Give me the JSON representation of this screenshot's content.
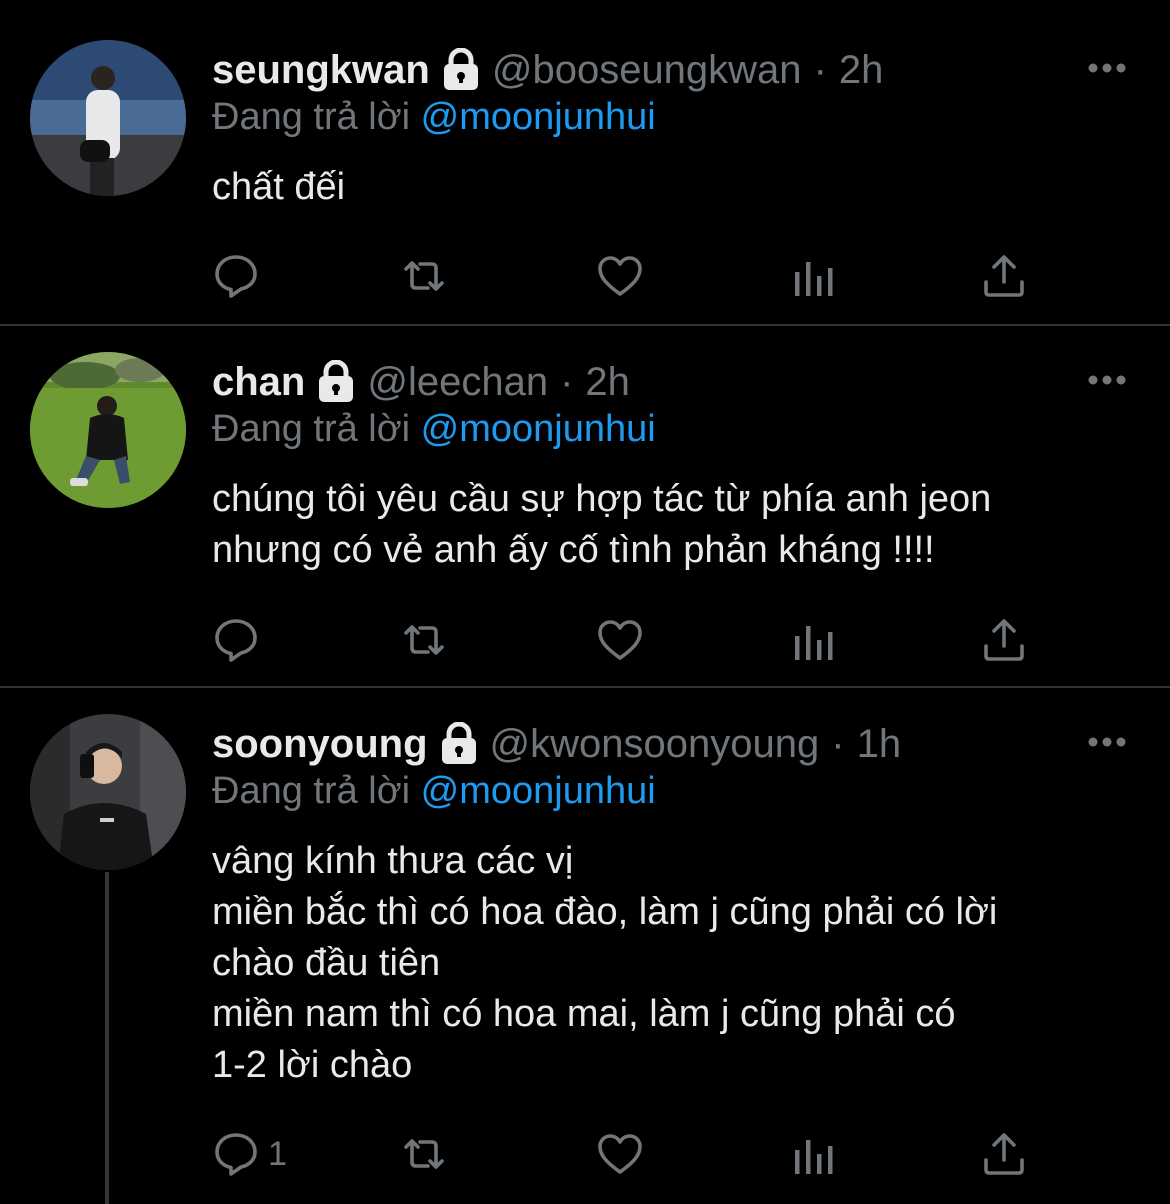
{
  "tweets": [
    {
      "name": "seungkwan",
      "handle": "@booseungkwan",
      "separator": "·",
      "time": "2h",
      "replying_prefix": "Đang trả lời",
      "replying_to": "@moonjunhui",
      "lines": [
        "chất đếi"
      ],
      "reply_count": ""
    },
    {
      "name": "chan",
      "handle": "@leechan",
      "separator": "·",
      "time": "2h",
      "replying_prefix": "Đang trả lời",
      "replying_to": "@moonjunhui",
      "lines": [
        "chúng tôi yêu cầu sự hợp tác từ phía anh jeon",
        "nhưng có vẻ anh ấy cố tình phản kháng !!!!"
      ],
      "reply_count": ""
    },
    {
      "name": "soonyoung",
      "handle": "@kwonsoonyoung",
      "separator": "·",
      "time": "1h",
      "replying_prefix": "Đang trả lời",
      "replying_to": "@moonjunhui",
      "lines": [
        "vâng kính thưa các vị",
        "miền bắc thì có hoa đào, làm j cũng phải có lời",
        "chào đầu tiên",
        "miền nam thì có hoa mai, làm j cũng phải có",
        "1-2 lời chào"
      ],
      "reply_count": "1"
    }
  ],
  "icons": {
    "lock": "lock-icon",
    "more": "more-icon",
    "reply": "reply-icon",
    "retweet": "retweet-icon",
    "like": "like-icon",
    "analytics": "analytics-icon",
    "share": "share-icon"
  },
  "colors": {
    "background": "#000000",
    "text": "#e7e9ea",
    "muted": "#71767b",
    "accent": "#1d9bf0",
    "divider": "#2f3336"
  }
}
